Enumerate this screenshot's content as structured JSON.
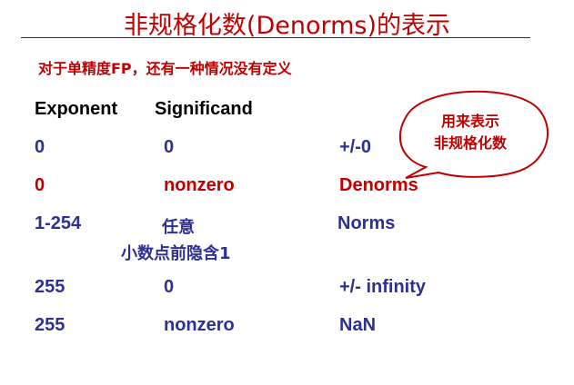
{
  "title": "非规格化数(Denorms)的表示",
  "subtitle": "对于单精度FP，还有一种情况没有定义",
  "headers": {
    "exponent": "Exponent",
    "significand": "Significand"
  },
  "rows": [
    {
      "exponent": "0",
      "significand": "0",
      "meaning": "+/-0"
    },
    {
      "exponent": "0",
      "significand": "nonzero",
      "meaning": "Denorms"
    },
    {
      "exponent": "1-254",
      "significand": "任意",
      "note": "小数点前隐含1",
      "meaning": "Norms"
    },
    {
      "exponent": "255",
      "significand": "0",
      "meaning": "+/- infinity"
    },
    {
      "exponent": "255",
      "significand": "nonzero",
      "meaning": "NaN"
    }
  ],
  "callout": {
    "line1": "用来表示",
    "line2": "非规格化数"
  },
  "colors": {
    "title": "#c00000",
    "header": "#000000",
    "row": "#2e3192",
    "highlight": "#c00000",
    "callout_fill": "#ffffff",
    "callout_stroke": "#c00000"
  }
}
